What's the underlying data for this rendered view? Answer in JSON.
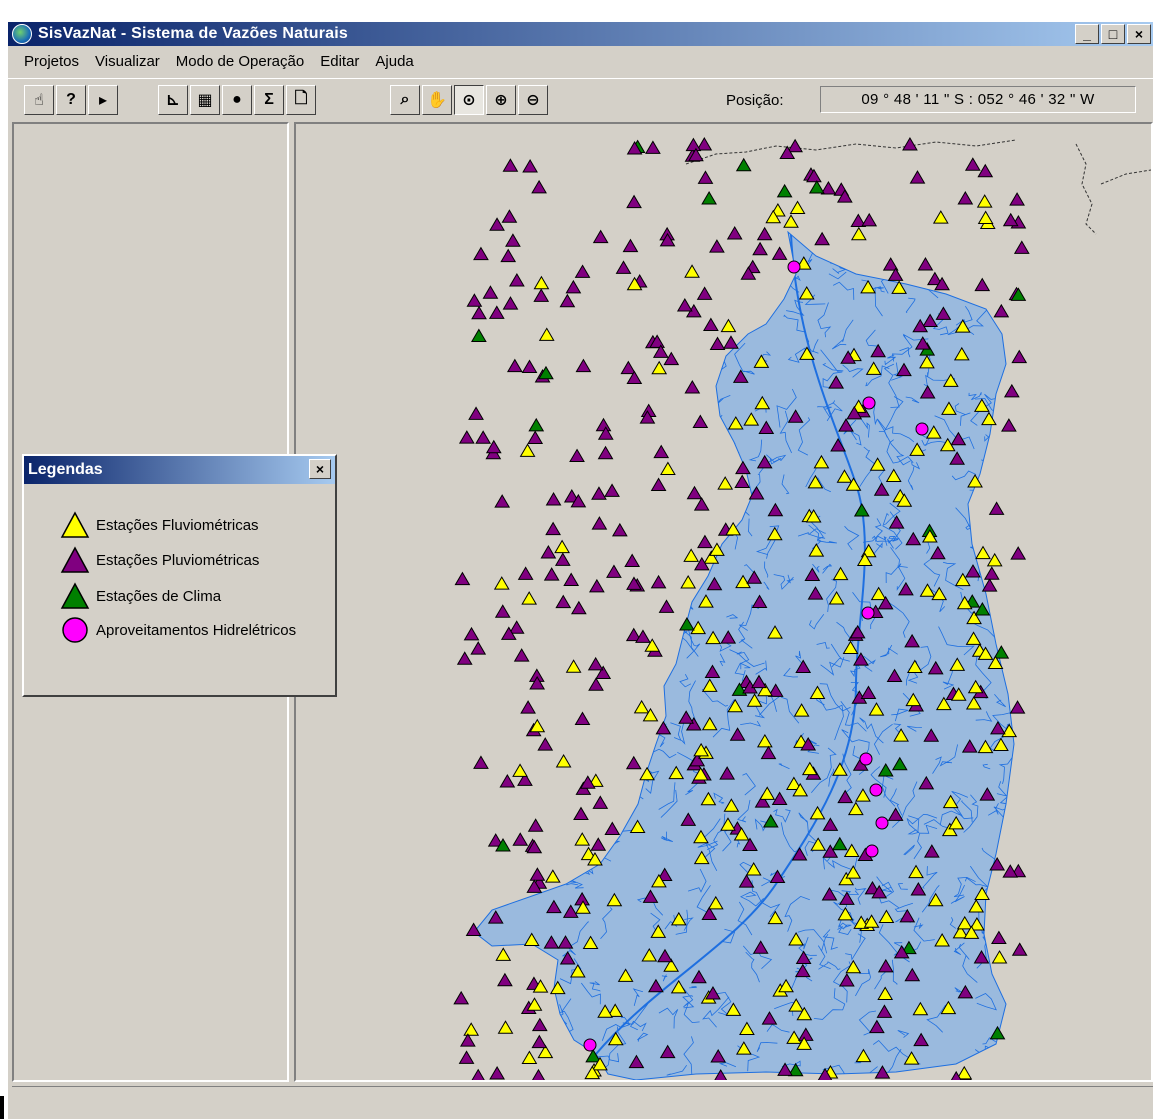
{
  "window": {
    "title": "SisVazNat - Sistema de Vazões Naturais",
    "controls": [
      "_",
      "□",
      "×"
    ]
  },
  "menu": [
    "Projetos",
    "Visualizar",
    "Modo de Operação",
    "Editar",
    "Ajuda"
  ],
  "toolbar": {
    "group1": [
      {
        "name": "pointer-tool-icon",
        "glyph": "☝"
      },
      {
        "name": "query-tool-icon",
        "glyph": "?"
      },
      {
        "name": "select-tool-icon",
        "glyph": "▸"
      }
    ],
    "group2": [
      {
        "name": "chart-icon",
        "glyph": "⊾"
      },
      {
        "name": "table-icon",
        "glyph": "▦"
      },
      {
        "name": "globe-icon",
        "glyph": "●"
      },
      {
        "name": "sum-icon",
        "glyph": "Σ"
      },
      {
        "name": "new-document-icon",
        "glyph": "🗋"
      }
    ],
    "group3": [
      {
        "name": "zoom-extent-icon",
        "glyph": "⌕"
      },
      {
        "name": "pan-hand-icon",
        "glyph": "✋"
      },
      {
        "name": "zoom-window-icon",
        "glyph": "⊙",
        "pressed": true
      },
      {
        "name": "zoom-in-icon",
        "glyph": "⊕"
      },
      {
        "name": "zoom-out-icon",
        "glyph": "⊖"
      }
    ],
    "position_label": "Posição:",
    "position_value": "09 ° 48 ' 11 \" S : 052 ° 46 ' 32 \" W"
  },
  "legend": {
    "title": "Legendas",
    "close": "×",
    "items": [
      {
        "label": "Estações Fluviométricas",
        "shape": "triangle",
        "color": "#ffff00"
      },
      {
        "label": "Estações Pluviométricas",
        "shape": "triangle",
        "color": "#800080"
      },
      {
        "label": "Estações de Clima",
        "shape": "triangle",
        "color": "#008000"
      },
      {
        "label": "Aproveitamentos Hidrelétricos",
        "shape": "circle",
        "color": "#ff00ff"
      }
    ]
  },
  "map": {
    "basin_color": "#6aa8f0",
    "river_color": "#1e6fe0",
    "background": "#d4d0c8"
  }
}
